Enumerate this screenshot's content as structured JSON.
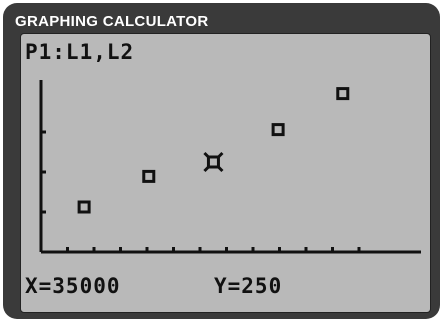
{
  "header": {
    "title": "GRAPHING CALCULATOR"
  },
  "screen": {
    "plot_label": "P1:L1,L2",
    "trace": {
      "x_readout": "X=35000",
      "y_readout": "Y=250"
    }
  },
  "chart_data": {
    "type": "scatter",
    "title": "",
    "xlabel": "",
    "ylabel": "",
    "x": [
      20000,
      27500,
      35000,
      42500,
      50000
    ],
    "y": [
      125,
      210,
      250,
      340,
      440
    ],
    "cursor_index": 2,
    "grid": false,
    "colors": {
      "lcd_background": "#b9b9b9",
      "ink": "#111111",
      "frame": "#3a3a3a"
    }
  }
}
